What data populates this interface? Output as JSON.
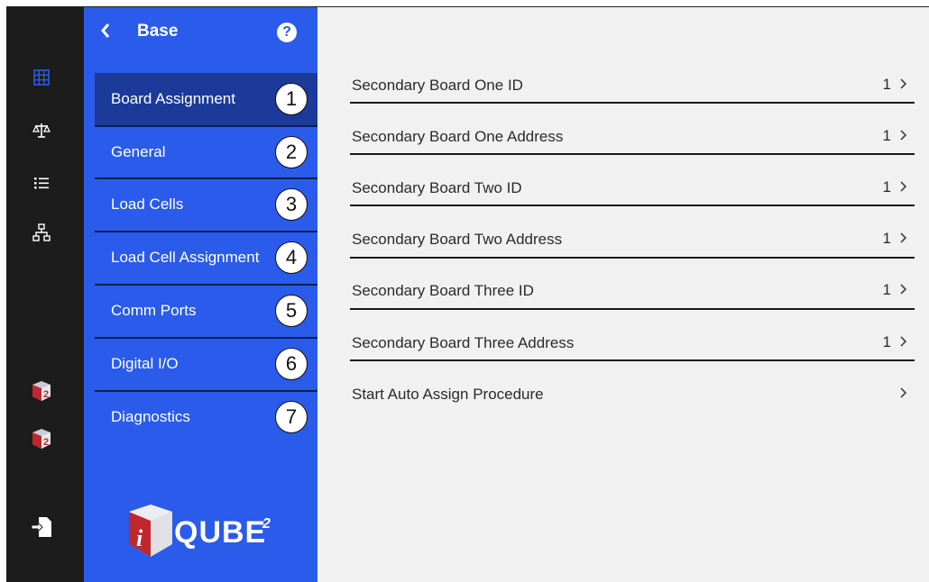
{
  "sidebar": {
    "title": "Base",
    "help_label": "?",
    "items": [
      {
        "label": "Board Assignment",
        "callout": "1"
      },
      {
        "label": "General",
        "callout": "2"
      },
      {
        "label": "Load Cells",
        "callout": "3"
      },
      {
        "label": "Load Cell Assignment",
        "callout": "4"
      },
      {
        "label": "Comm Ports",
        "callout": "5"
      },
      {
        "label": "Digital I/O",
        "callout": "6"
      },
      {
        "label": "Diagnostics",
        "callout": "7"
      }
    ],
    "logo_text": "QUBE",
    "logo_superscript": "2"
  },
  "rail": {
    "icons": [
      "grid-icon",
      "scale-icon",
      "list-icon",
      "network-icon",
      "iqube-icon",
      "iqube-icon",
      "logout-icon"
    ],
    "accent": "#2a5bea"
  },
  "main": {
    "rows": [
      {
        "label": "Secondary Board One ID",
        "value": "1"
      },
      {
        "label": "Secondary Board One Address",
        "value": "1"
      },
      {
        "label": "Secondary Board Two ID",
        "value": "1"
      },
      {
        "label": "Secondary Board Two Address",
        "value": "1"
      },
      {
        "label": "Secondary Board Three ID",
        "value": "1"
      },
      {
        "label": "Secondary Board Three Address",
        "value": "1"
      },
      {
        "label": "Start Auto Assign Procedure",
        "value": ""
      }
    ]
  },
  "colors": {
    "sidebar_bg": "#2a5bea",
    "sidebar_active": "#1b3a99",
    "rail_bg": "#1c1c1c",
    "main_bg": "#f1f1f1"
  }
}
